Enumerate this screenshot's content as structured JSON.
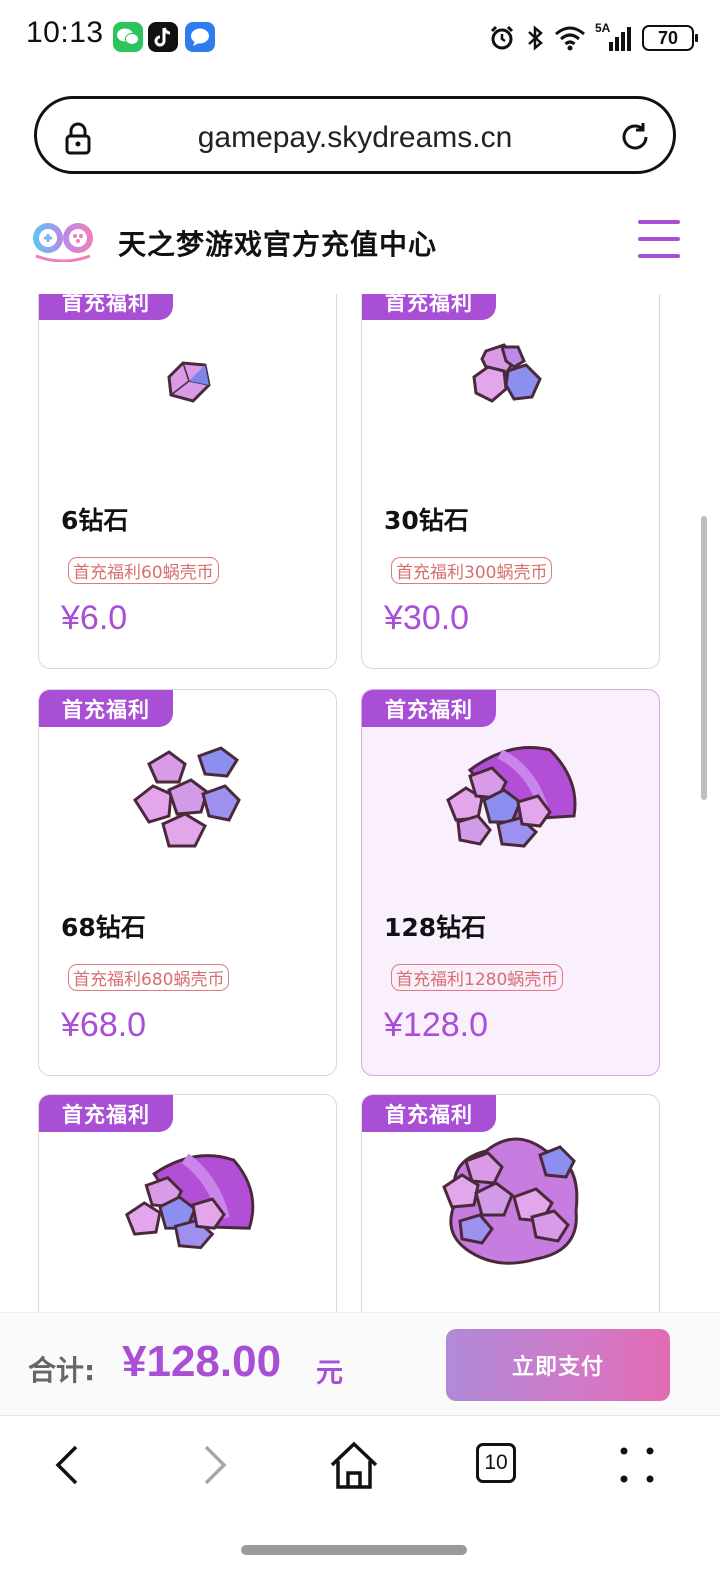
{
  "status_bar": {
    "time": "10:13",
    "network": "5A",
    "battery": "70"
  },
  "browser": {
    "url": "gamepay.skydreams.cn",
    "tab_count": "10"
  },
  "header": {
    "title": "天之梦游戏官方充值中心"
  },
  "products": [
    {
      "badge": "首充福利",
      "name": "6钻石",
      "bonus": "首充福利60蜗壳币",
      "price": "¥6.0",
      "selected": false,
      "gem": "single-gem"
    },
    {
      "badge": "首充福利",
      "name": "30钻石",
      "bonus": "首充福利300蜗壳币",
      "price": "¥30.0",
      "selected": false,
      "gem": "small-gem-cluster"
    },
    {
      "badge": "首充福利",
      "name": "68钻石",
      "bonus": "首充福利680蜗壳币",
      "price": "¥68.0",
      "selected": false,
      "gem": "gem-pile"
    },
    {
      "badge": "首充福利",
      "name": "128钻石",
      "bonus": "首充福利1280蜗壳币",
      "price": "¥128.0",
      "selected": true,
      "gem": "gem-bag"
    },
    {
      "badge": "首充福利",
      "gem": "gem-bag-large"
    },
    {
      "badge": "首充福利",
      "gem": "gem-treasure"
    }
  ],
  "footer": {
    "total_label": "合计:",
    "total_amount": "¥128.00",
    "total_unit": "元",
    "pay_button": "立即支付"
  },
  "colors": {
    "accent": "#a84fd6",
    "bonus_tag": "#d86e6e",
    "selected_card_bg": "#faeffc"
  }
}
